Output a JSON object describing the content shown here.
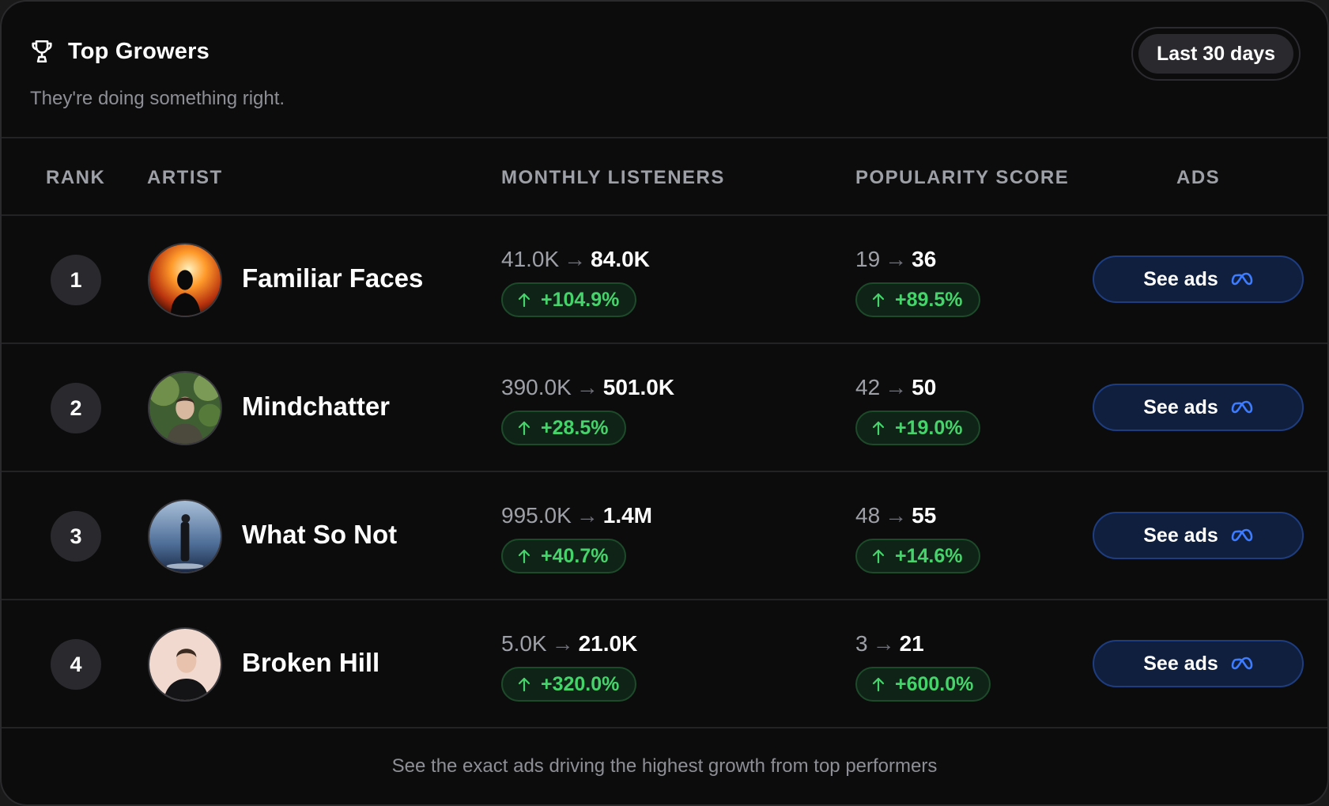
{
  "header": {
    "title": "Top Growers",
    "subtitle": "They're doing something right.",
    "range_label": "Last 30 days",
    "icon": "trophy-icon"
  },
  "columns": {
    "rank": "RANK",
    "artist": "ARTIST",
    "listeners": "MONTHLY LISTENERS",
    "popularity": "POPULARITY SCORE",
    "ads": "ADS"
  },
  "rows": [
    {
      "rank": "1",
      "artist": "Familiar Faces",
      "listeners_from": "41.0K",
      "listeners_to": "84.0K",
      "listeners_change": "+104.9%",
      "popularity_from": "19",
      "popularity_to": "36",
      "popularity_change": "+89.5%",
      "ads_label": "See ads"
    },
    {
      "rank": "2",
      "artist": "Mindchatter",
      "listeners_from": "390.0K",
      "listeners_to": "501.0K",
      "listeners_change": "+28.5%",
      "popularity_from": "42",
      "popularity_to": "50",
      "popularity_change": "+19.0%",
      "ads_label": "See ads"
    },
    {
      "rank": "3",
      "artist": "What So Not",
      "listeners_from": "995.0K",
      "listeners_to": "1.4M",
      "listeners_change": "+40.7%",
      "popularity_from": "48",
      "popularity_to": "55",
      "popularity_change": "+14.6%",
      "ads_label": "See ads"
    },
    {
      "rank": "4",
      "artist": "Broken Hill",
      "listeners_from": "5.0K",
      "listeners_to": "21.0K",
      "listeners_change": "+320.0%",
      "popularity_from": "3",
      "popularity_to": "21",
      "popularity_change": "+600.0%",
      "ads_label": "See ads"
    }
  ],
  "arrow_symbol": "→",
  "footer": {
    "text": "See the exact ads driving the highest growth from top performers"
  },
  "colors": {
    "background": "#0c0c0d",
    "growth_green": "#46d36c",
    "ads_blue": "#1e3d80",
    "muted_text": "#9ea0a8"
  }
}
